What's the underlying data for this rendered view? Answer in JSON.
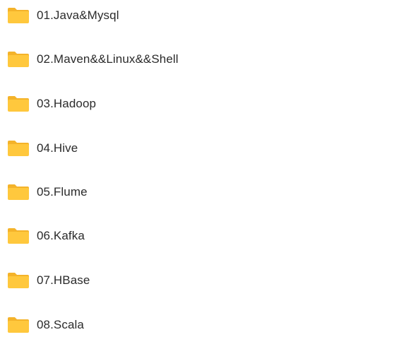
{
  "folders": [
    {
      "name": "01.Java&Mysql",
      "icon": "folder-icon"
    },
    {
      "name": "02.Maven&&Linux&&Shell",
      "icon": "folder-icon"
    },
    {
      "name": "03.Hadoop",
      "icon": "folder-icon"
    },
    {
      "name": "04.Hive",
      "icon": "folder-icon"
    },
    {
      "name": "05.Flume",
      "icon": "folder-icon"
    },
    {
      "name": "06.Kafka",
      "icon": "folder-icon"
    },
    {
      "name": "07.HBase",
      "icon": "folder-icon"
    },
    {
      "name": "08.Scala",
      "icon": "folder-icon"
    }
  ],
  "colors": {
    "folder_body": "#FFC83D",
    "folder_back": "#F4B32A",
    "label_text": "#2B2B2B",
    "background": "#FFFFFF"
  }
}
